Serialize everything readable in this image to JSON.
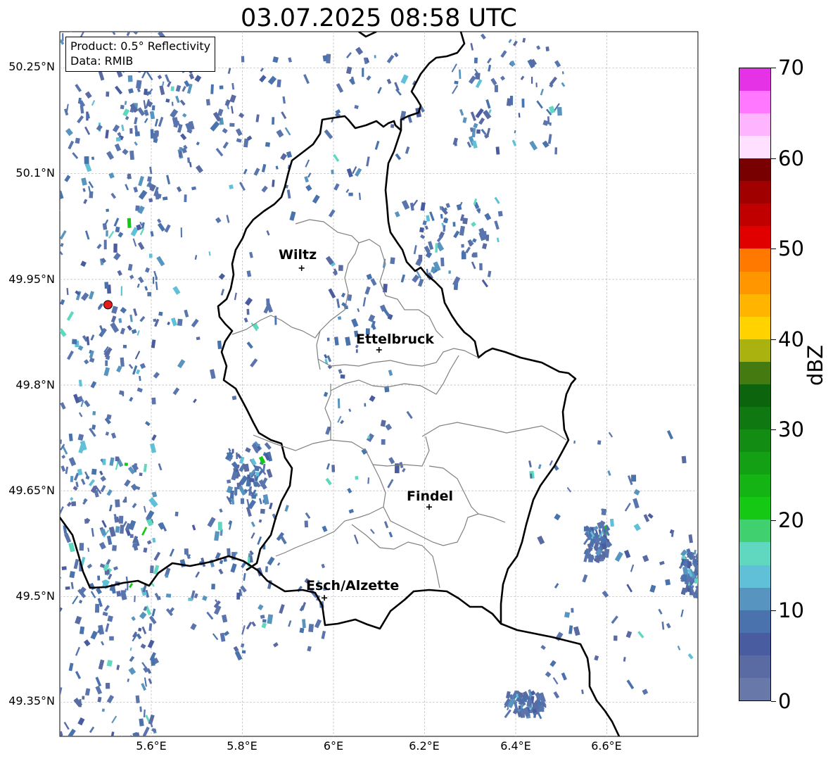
{
  "title": "03.07.2025 08:58 UTC",
  "info": {
    "product": "Product: 0.5° Reflectivity",
    "data_source": "Data: RMIB"
  },
  "axes": {
    "lat_labels": [
      "50.25°N",
      "50.1°N",
      "49.95°N",
      "49.8°N",
      "49.65°N",
      "49.5°N",
      "49.35°N"
    ],
    "lon_labels": [
      "5.6°E",
      "5.8°E",
      "6°E",
      "6.2°E",
      "6.4°E",
      "6.6°E"
    ]
  },
  "cities": [
    {
      "name": "Wiltz",
      "lon": 5.93,
      "lat": 49.966
    },
    {
      "name": "Ettelbruck",
      "lon": 6.1,
      "lat": 49.85
    },
    {
      "name": "Findel",
      "lon": 6.21,
      "lat": 49.627
    },
    {
      "name": "Esch/Alzette",
      "lon": 5.98,
      "lat": 49.498
    }
  ],
  "radar_site": {
    "lon": 5.505,
    "lat": 49.914,
    "color": "#e41a1c"
  },
  "colorbar": {
    "label": "dBZ",
    "min": 0,
    "max": 70,
    "ticks": [
      "0",
      "10",
      "20",
      "30",
      "40",
      "50",
      "60",
      "70"
    ],
    "colors": [
      "#6878a8",
      "#5a6aa2",
      "#4a5ca0",
      "#4a72ac",
      "#5894c0",
      "#60c0d8",
      "#60d8c0",
      "#40d070",
      "#14c814",
      "#14b414",
      "#14a014",
      "#128c12",
      "#107810",
      "#0c640c",
      "#457a10",
      "#aab210",
      "#ffd200",
      "#ffb400",
      "#ff9600",
      "#ff7800",
      "#e00000",
      "#c00000",
      "#a00000",
      "#780000",
      "#ffe0ff",
      "#ffb4ff",
      "#ff78ff",
      "#e632e6"
    ]
  },
  "colors": {
    "border": "#000000",
    "canton_boundary": "#808080",
    "gridline": "#bbbbbb",
    "echo_primary": "#5a74ae"
  }
}
